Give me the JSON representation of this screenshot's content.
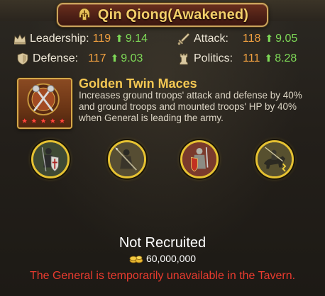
{
  "general": {
    "name": "Qin Qiong(Awakened)"
  },
  "stats": [
    {
      "name": "Leadership:",
      "value": "119",
      "bonus": "9.14",
      "icon": "crown-icon"
    },
    {
      "name": "Attack:",
      "value": "118",
      "bonus": "9.05",
      "icon": "sword-icon"
    },
    {
      "name": "Defense:",
      "value": "117",
      "bonus": "9.03",
      "icon": "shield-icon"
    },
    {
      "name": "Politics:",
      "value": "111",
      "bonus": "8.28",
      "icon": "rook-icon"
    }
  ],
  "skill": {
    "name": "Golden Twin Maces",
    "description": "Increases ground troops' attack and defense by 40% and ground troops and mounted troops' HP by 40% when General is leading the army.",
    "stars": 5,
    "icon": "twin-maces-icon"
  },
  "troops": [
    {
      "icon": "shield-infantry-icon",
      "bg": "#45513a"
    },
    {
      "icon": "spearman-icon",
      "bg": "#5b5338"
    },
    {
      "icon": "heavy-infantry-icon",
      "bg": "#8a3a2a"
    },
    {
      "icon": "cavalry-icon",
      "bg": "#5a5232"
    }
  ],
  "recruit": {
    "status": "Not Recruited",
    "cost": "60,000,000",
    "cost_icon": "gold-coins-icon",
    "message": "The General is temporarily unavailable in the Tavern."
  },
  "colors": {
    "title": "#f4cf6a",
    "stat_value": "#f0a040",
    "stat_bonus": "#7ed957",
    "warning": "#e93b2f",
    "gold_border": "#caa45c"
  }
}
